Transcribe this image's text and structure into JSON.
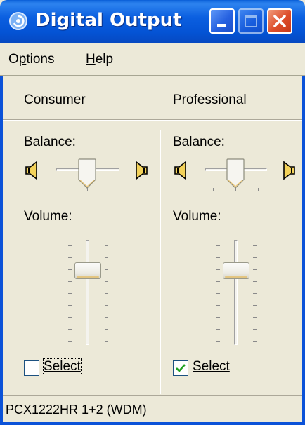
{
  "window": {
    "title": "Digital Output",
    "icon": "speaker-swirl-icon",
    "controls": [
      "minimize-icon",
      "maximize-icon",
      "close-icon"
    ]
  },
  "menu": {
    "options": "Options",
    "help": "Help"
  },
  "panels": [
    {
      "name": "Consumer",
      "balance_label": "Balance:",
      "balance_level": 0.5,
      "volume_label": "Volume:",
      "volume_level": 0.75,
      "select_label": "Select",
      "selected": false
    },
    {
      "name": "Professional",
      "balance_label": "Balance:",
      "balance_level": 0.5,
      "volume_label": "Volume:",
      "volume_level": 0.75,
      "select_label": "Select",
      "selected": true
    }
  ],
  "status": {
    "text": "PCX1222HR 1+2 (WDM)"
  },
  "colors": {
    "titlebar": "#0453d4",
    "window_bg": "#ece9d8",
    "checkmark": "#21a121"
  }
}
